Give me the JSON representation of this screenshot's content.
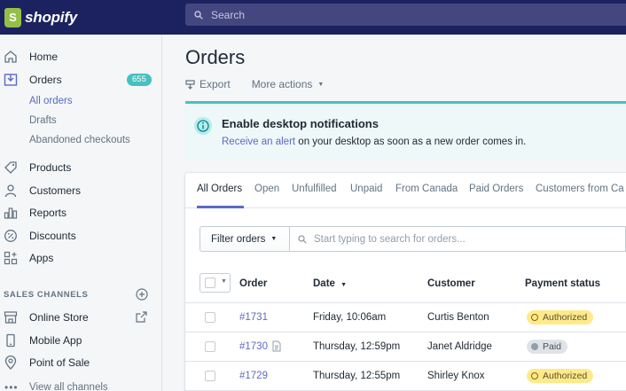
{
  "brand": {
    "name": "shopify",
    "logo_letter": "S"
  },
  "search": {
    "placeholder": "Search"
  },
  "sidebar": {
    "items": [
      {
        "label": "Home",
        "icon": "home-icon"
      },
      {
        "label": "Orders",
        "icon": "orders-icon",
        "badge": "655"
      },
      {
        "label": "Products",
        "icon": "tag-icon"
      },
      {
        "label": "Customers",
        "icon": "person-icon"
      },
      {
        "label": "Reports",
        "icon": "bar-chart-icon"
      },
      {
        "label": "Discounts",
        "icon": "discount-icon"
      },
      {
        "label": "Apps",
        "icon": "apps-icon"
      }
    ],
    "order_subitems": [
      "All orders",
      "Drafts",
      "Abandoned checkouts"
    ],
    "sales_channels_title": "SALES CHANNELS",
    "channels": [
      {
        "label": "Online Store",
        "icon": "store-icon"
      },
      {
        "label": "Mobile App",
        "icon": "phone-icon"
      },
      {
        "label": "Point of Sale",
        "icon": "location-icon"
      }
    ],
    "view_all": "View all channels"
  },
  "page": {
    "title": "Orders",
    "export_label": "Export",
    "more_actions_label": "More actions"
  },
  "banner": {
    "title": "Enable desktop notifications",
    "link_text": "Receive an alert",
    "text": " on your desktop as soon as a new order comes in."
  },
  "tabs": [
    "All Orders",
    "Open",
    "Unfulfilled",
    "Unpaid",
    "From Canada",
    "Paid Orders",
    "Customers from Ca"
  ],
  "filter": {
    "button_label": "Filter orders",
    "placeholder": "Start typing to search for orders..."
  },
  "table": {
    "headers": {
      "order": "Order",
      "date": "Date",
      "customer": "Customer",
      "payment": "Payment status"
    },
    "rows": [
      {
        "order": "#1731",
        "date": "Friday, 10:06am",
        "customer": "Curtis Benton",
        "payment": "Authorized",
        "payment_kind": "authorized",
        "has_note": false
      },
      {
        "order": "#1730",
        "date": "Thursday, 12:59pm",
        "customer": "Janet Aldridge",
        "payment": "Paid",
        "payment_kind": "paid",
        "has_note": true
      },
      {
        "order": "#1729",
        "date": "Thursday, 12:55pm",
        "customer": "Shirley Knox",
        "payment": "Authorized",
        "payment_kind": "authorized",
        "has_note": false
      }
    ]
  },
  "colors": {
    "topbar": "#1c2260",
    "accent": "#5c6ac4",
    "badge_teal": "#47c1bf",
    "authorized_bg": "#ffea8a",
    "paid_bg": "#dfe3e8"
  }
}
